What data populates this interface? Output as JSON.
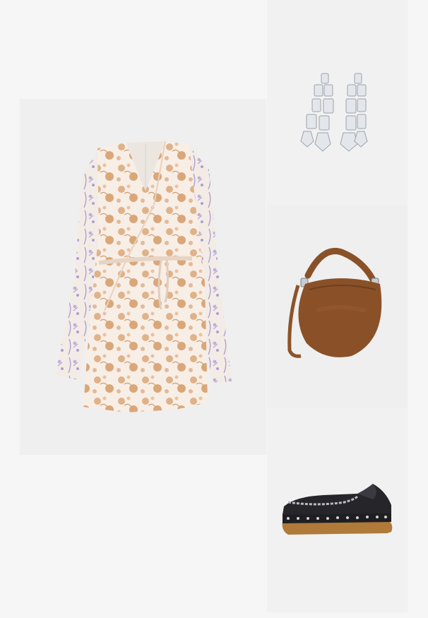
{
  "outfit": {
    "items": [
      {
        "id": "dress",
        "icon": "floral-wrap-dress-icon"
      },
      {
        "id": "earrings",
        "icon": "crystal-drop-earrings-icon"
      },
      {
        "id": "bag",
        "icon": "suede-hobo-bag-icon"
      },
      {
        "id": "clogs",
        "icon": "studded-clog-icon"
      }
    ]
  },
  "colors": {
    "page_background": "#f6f6f6",
    "dress_base": "#f5ebe3",
    "dress_flower_orange": "#d9a06e",
    "dress_flower_lilac": "#a799cf",
    "bag_suede": "#8a5128",
    "clog_leather": "#1f1f22",
    "clog_wood": "#b07a3a",
    "crystal": "#d9dde3"
  }
}
